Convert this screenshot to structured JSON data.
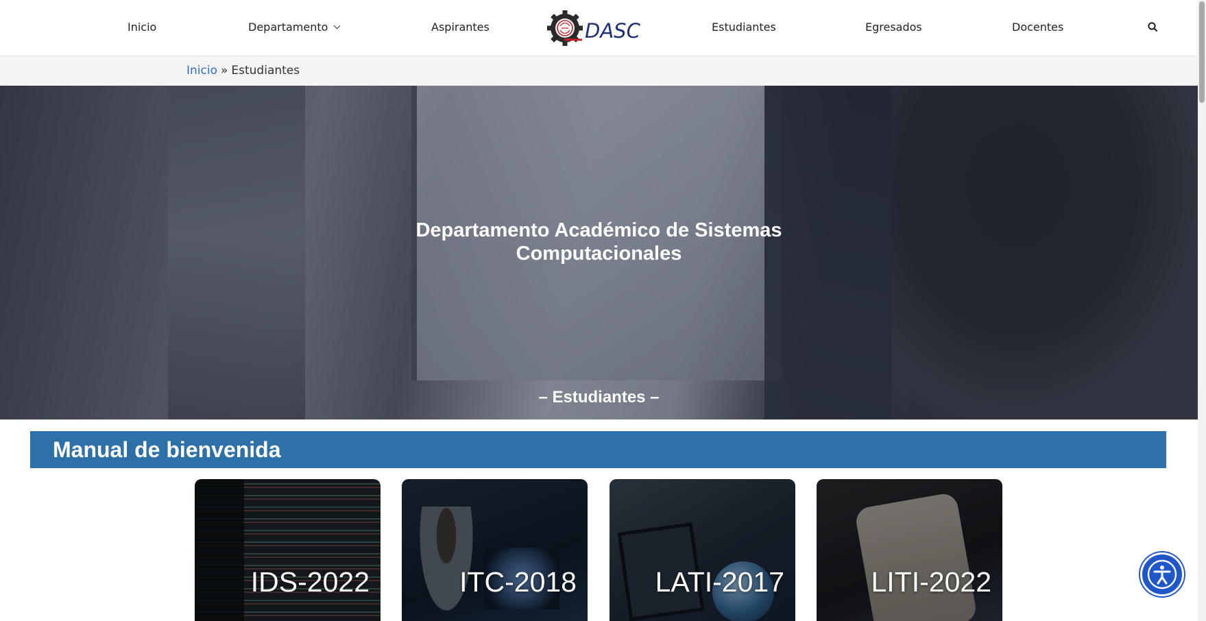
{
  "header": {
    "nav": {
      "inicio": "Inicio",
      "departamento": "Departamento",
      "aspirantes": "Aspirantes",
      "estudiantes": "Estudiantes",
      "egresados": "Egresados",
      "docentes": "Docentes"
    },
    "logo_text": "DASC",
    "search_icon": "search-icon"
  },
  "breadcrumb": {
    "home": "Inicio",
    "separator": "»",
    "current": "Estudiantes"
  },
  "hero": {
    "title_line1": "Departamento Académico de Sistemas",
    "title_line2": "Computacionales",
    "subtitle": "– Estudiantes –"
  },
  "section": {
    "title": "Manual de bienvenida"
  },
  "cards": [
    {
      "label": "IDS-2022"
    },
    {
      "label": "ITC-2018"
    },
    {
      "label": "LATI-2017"
    },
    {
      "label": "LITI-2022"
    }
  ],
  "accessibility": {
    "icon": "accessibility-icon"
  },
  "colors": {
    "brand_blue": "#2e70a8",
    "link_blue": "#2e6fc4",
    "a11y_blue": "#1f56c8",
    "logo_red": "#c8202a",
    "logo_navy": "#1e2f7a"
  }
}
